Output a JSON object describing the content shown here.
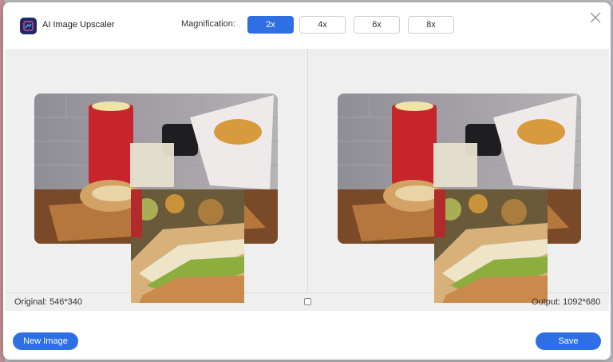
{
  "app": {
    "title": "AI Image Upscaler"
  },
  "magnification": {
    "label": "Magnification:",
    "options": [
      "2x",
      "4x",
      "6x",
      "8x"
    ],
    "selected": "2x"
  },
  "preview": {
    "original_label": "Original: 546*340",
    "output_label": "Output: 1092*680"
  },
  "footer": {
    "new_image_label": "New Image",
    "save_label": "Save"
  },
  "icons": {
    "app_logo": "app-logo-icon",
    "close": "close-icon",
    "split": "split-view-icon"
  },
  "colors": {
    "accent": "#2f6fe4",
    "logo_bg": "#1d2a63"
  }
}
